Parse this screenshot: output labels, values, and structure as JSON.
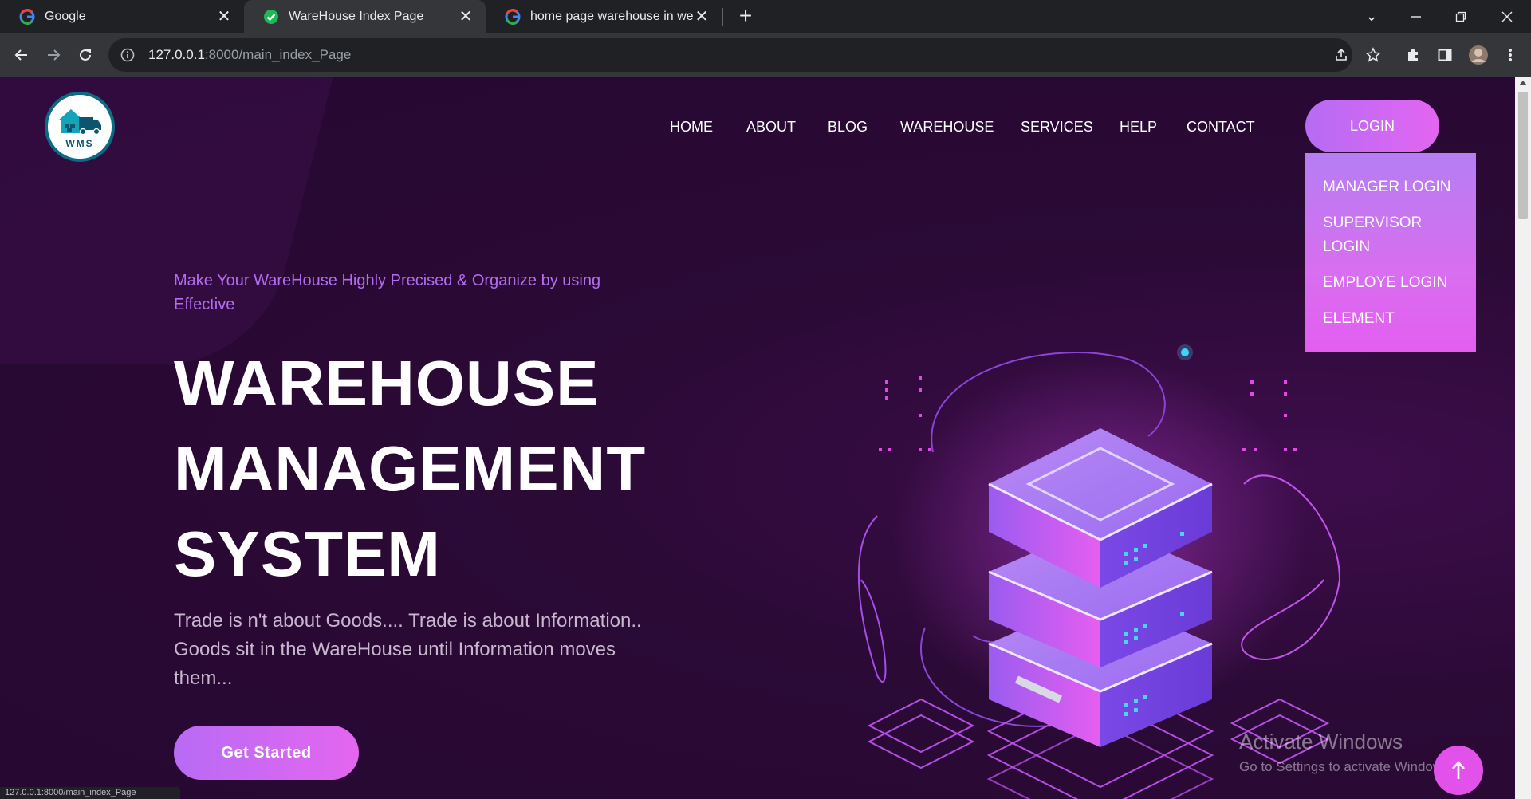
{
  "browser": {
    "tabs": [
      {
        "title": "Google",
        "favicon": "google-icon"
      },
      {
        "title": "WareHouse Index Page",
        "favicon": "check-icon"
      },
      {
        "title": "home page warehouse in website",
        "favicon": "google-icon"
      }
    ],
    "active_tab": 1,
    "url_host": "127.0.0.1",
    "url_rest": ":8000/main_index_Page",
    "status_text": "127.0.0.1:8000/main_index_Page"
  },
  "site": {
    "logo_text": "WMS",
    "nav": [
      "HOME",
      "ABOUT",
      "BLOG",
      "WAREHOUSE",
      "SERVICES",
      "HELP",
      "CONTACT"
    ],
    "login_label": "LOGIN",
    "login_menu": [
      "MANAGER LOGIN",
      "SUPERVISOR LOGIN",
      "EMPLOYE LOGIN",
      "ELEMENT"
    ]
  },
  "hero": {
    "tagline": "Make Your WareHouse Highly Precised & Organize by using Effective",
    "headline_1": "WAREHOUSE",
    "headline_2": "MANAGEMENT",
    "headline_3": "SYSTEM",
    "body": "Trade is n't about Goods.... Trade is about Information.. Goods sit in the WareHouse until Information moves them...",
    "cta": "Get Started"
  },
  "watermark": {
    "line1": "Activate Windows",
    "line2": "Go to Settings to activate Windows."
  },
  "colors": {
    "page_bg": "#260831",
    "accent": "#d86ef0",
    "tagline": "#b46cf0"
  }
}
